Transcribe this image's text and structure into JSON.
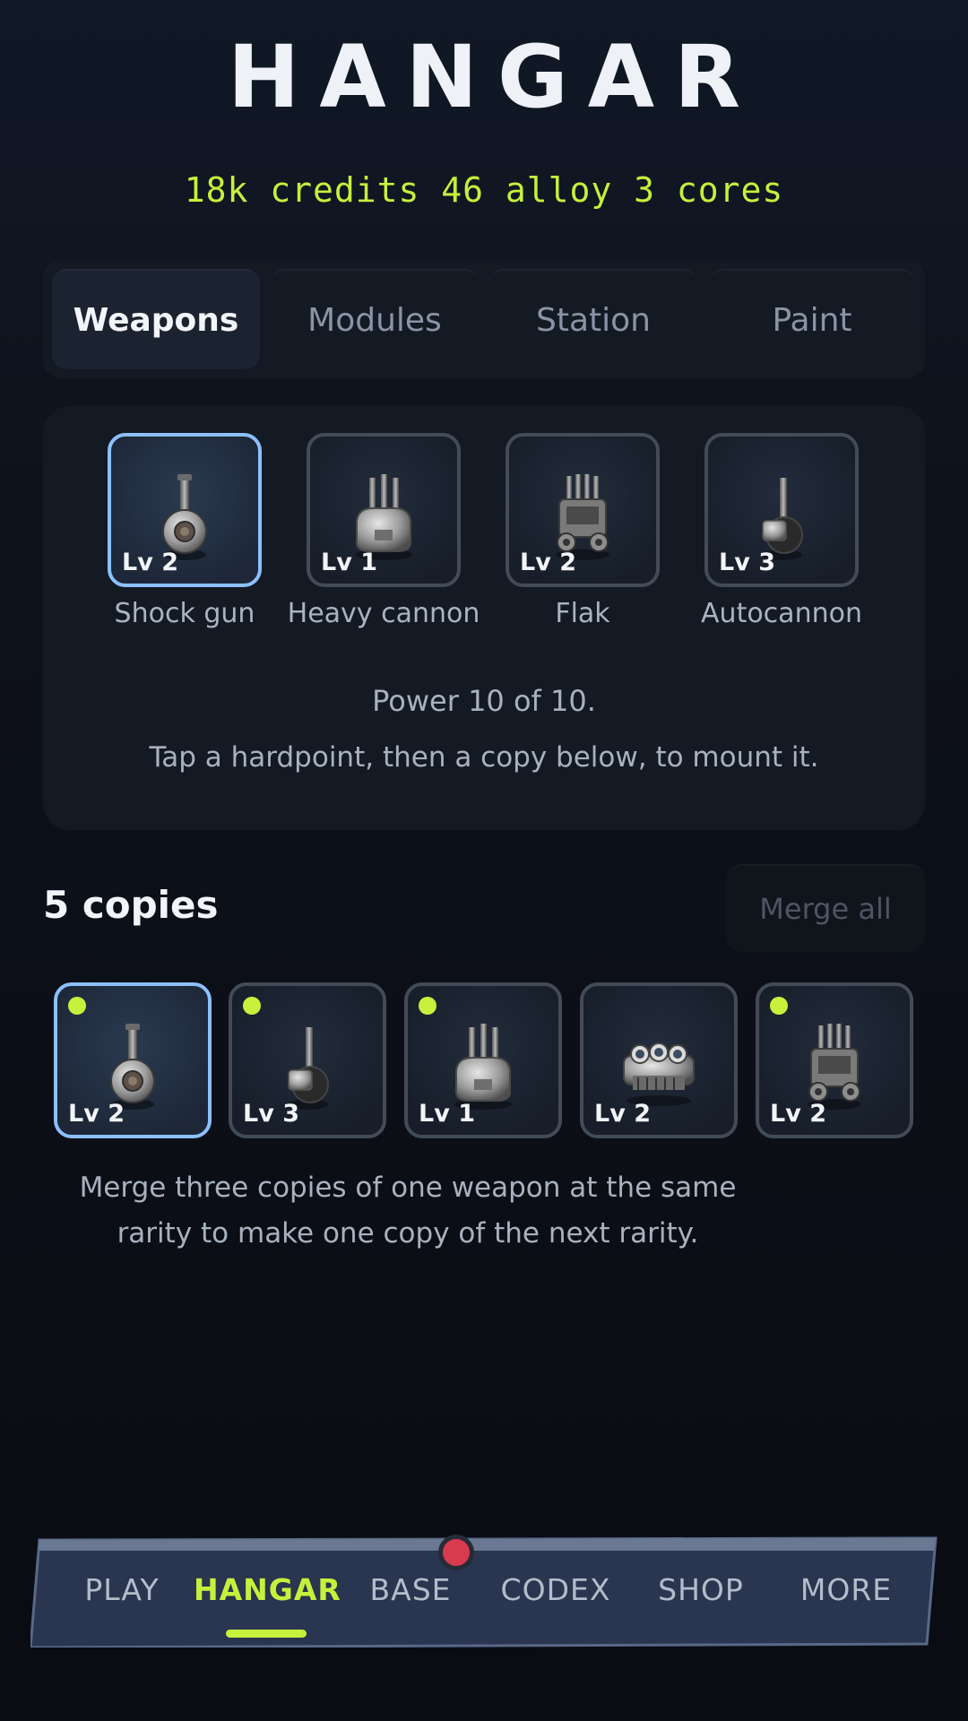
{
  "header": {
    "title": "HANGAR",
    "resources": "18k credits 46 alloy 3 cores"
  },
  "tabs": [
    {
      "label": "Weapons",
      "active": true
    },
    {
      "label": "Modules",
      "active": false
    },
    {
      "label": "Station",
      "active": false
    },
    {
      "label": "Paint",
      "active": false
    }
  ],
  "hardpoints": [
    {
      "name": "Shock gun",
      "level": "Lv 2",
      "icon": "shock-gun-icon",
      "selected": true
    },
    {
      "name": "Heavy cannon",
      "level": "Lv 1",
      "icon": "heavy-cannon-icon",
      "selected": false
    },
    {
      "name": "Flak",
      "level": "Lv 2",
      "icon": "flak-icon",
      "selected": false
    },
    {
      "name": "Autocannon",
      "level": "Lv 3",
      "icon": "autocannon-icon",
      "selected": false
    }
  ],
  "loadout": {
    "power_text": "Power 10 of 10.",
    "hint": "Tap a hardpoint, then a copy below, to mount it."
  },
  "copies": {
    "title": "5 copies",
    "merge_label": "Merge all",
    "items": [
      {
        "level": "Lv 2",
        "icon": "shock-gun-icon",
        "indicator": true,
        "selected": true
      },
      {
        "level": "Lv 3",
        "icon": "autocannon-icon",
        "indicator": true,
        "selected": false
      },
      {
        "level": "Lv 1",
        "icon": "heavy-cannon-icon",
        "indicator": true,
        "selected": false
      },
      {
        "level": "Lv 2",
        "icon": "missile-pod-icon",
        "indicator": false,
        "selected": false
      },
      {
        "level": "Lv 2",
        "icon": "flak-icon",
        "indicator": true,
        "selected": false
      }
    ],
    "info": "Merge three copies of one weapon at the same rarity to make one copy of the next rarity."
  },
  "nav": {
    "items": [
      {
        "label": "PLAY"
      },
      {
        "label": "HANGAR",
        "active": true
      },
      {
        "label": "BASE",
        "badge": true
      },
      {
        "label": "CODEX"
      },
      {
        "label": "SHOP"
      },
      {
        "label": "MORE"
      }
    ]
  },
  "colors": {
    "accent": "#c6f03c",
    "selected_border": "#8cc0ff",
    "badge": "#d83a4e",
    "nav_bar": "#2a3550"
  }
}
